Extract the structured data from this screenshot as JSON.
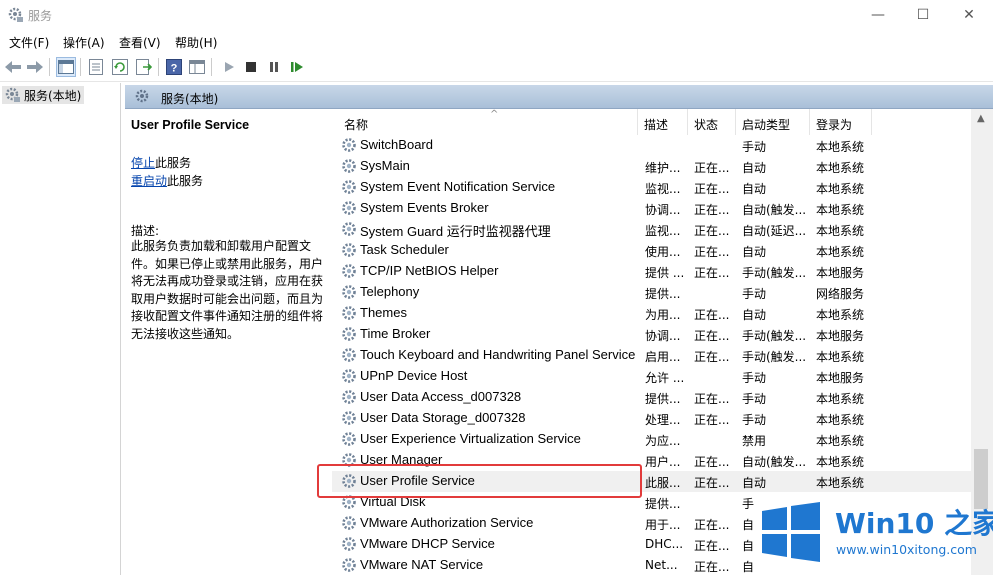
{
  "window": {
    "title": "服务",
    "minimize": "—",
    "maximize": "☐",
    "close": "✕"
  },
  "menu": [
    "文件(F)",
    "操作(A)",
    "查看(V)",
    "帮助(H)"
  ],
  "tree": {
    "root_label": "服务(本地)"
  },
  "pane": {
    "header_title": "服务(本地)"
  },
  "desc": {
    "service_title": "User Profile Service",
    "stop_link": "停止",
    "stop_suffix": "此服务",
    "restart_link": "重启动",
    "restart_suffix": "此服务",
    "label": "描述:",
    "body": "此服务负责加载和卸载用户配置文件。如果已停止或禁用此服务，用户将无法再成功登录或注销，应用在获取用户数据时可能会出问题，而且为接收配置文件事件通知注册的组件将无法接收这些通知。"
  },
  "columns": {
    "name": "名称",
    "desc": "描述",
    "status": "状态",
    "start": "启动类型",
    "logon": "登录为"
  },
  "rows": [
    {
      "name": "SwitchBoard",
      "desc": "",
      "status": "",
      "start": "手动",
      "logon": "本地系统"
    },
    {
      "name": "SysMain",
      "desc": "维护...",
      "status": "正在...",
      "start": "自动",
      "logon": "本地系统"
    },
    {
      "name": "System Event Notification Service",
      "desc": "监视...",
      "status": "正在...",
      "start": "自动",
      "logon": "本地系统"
    },
    {
      "name": "System Events Broker",
      "desc": "协调...",
      "status": "正在...",
      "start": "自动(触发...",
      "logon": "本地系统"
    },
    {
      "name": "System Guard 运行时监视器代理",
      "desc": "监视...",
      "status": "正在...",
      "start": "自动(延迟...",
      "logon": "本地系统"
    },
    {
      "name": "Task Scheduler",
      "desc": "使用...",
      "status": "正在...",
      "start": "自动",
      "logon": "本地系统"
    },
    {
      "name": "TCP/IP NetBIOS Helper",
      "desc": "提供 ...",
      "status": "正在...",
      "start": "手动(触发...",
      "logon": "本地服务"
    },
    {
      "name": "Telephony",
      "desc": "提供...",
      "status": "",
      "start": "手动",
      "logon": "网络服务"
    },
    {
      "name": "Themes",
      "desc": "为用...",
      "status": "正在...",
      "start": "自动",
      "logon": "本地系统"
    },
    {
      "name": "Time Broker",
      "desc": "协调...",
      "status": "正在...",
      "start": "手动(触发...",
      "logon": "本地服务"
    },
    {
      "name": "Touch Keyboard and Handwriting Panel Service",
      "desc": "启用...",
      "status": "正在...",
      "start": "手动(触发...",
      "logon": "本地系统"
    },
    {
      "name": "UPnP Device Host",
      "desc": "允许 ...",
      "status": "",
      "start": "手动",
      "logon": "本地服务"
    },
    {
      "name": "User Data Access_d007328",
      "desc": "提供...",
      "status": "正在...",
      "start": "手动",
      "logon": "本地系统"
    },
    {
      "name": "User Data Storage_d007328",
      "desc": "处理...",
      "status": "正在...",
      "start": "手动",
      "logon": "本地系统"
    },
    {
      "name": "User Experience Virtualization Service",
      "desc": "为应...",
      "status": "",
      "start": "禁用",
      "logon": "本地系统"
    },
    {
      "name": "User Manager",
      "desc": "用户...",
      "status": "正在...",
      "start": "自动(触发...",
      "logon": "本地系统"
    },
    {
      "name": "User Profile Service",
      "desc": "此服...",
      "status": "正在...",
      "start": "自动",
      "logon": "本地系统"
    },
    {
      "name": "Virtual Disk",
      "desc": "提供...",
      "status": "",
      "start": "手",
      "logon": ""
    },
    {
      "name": "VMware Authorization Service",
      "desc": "用于...",
      "status": "正在...",
      "start": "自",
      "logon": ""
    },
    {
      "name": "VMware DHCP Service",
      "desc": "DHC...",
      "status": "正在...",
      "start": "自",
      "logon": ""
    },
    {
      "name": "VMware NAT Service",
      "desc": "Net...",
      "status": "正在...",
      "start": "自",
      "logon": ""
    }
  ],
  "watermark": {
    "brand": "Win10 之家",
    "url": "www.win10xitong.com"
  },
  "colors": {
    "highlight": "#e23b3b",
    "link": "#0645ad",
    "brand": "#1f77d0"
  }
}
